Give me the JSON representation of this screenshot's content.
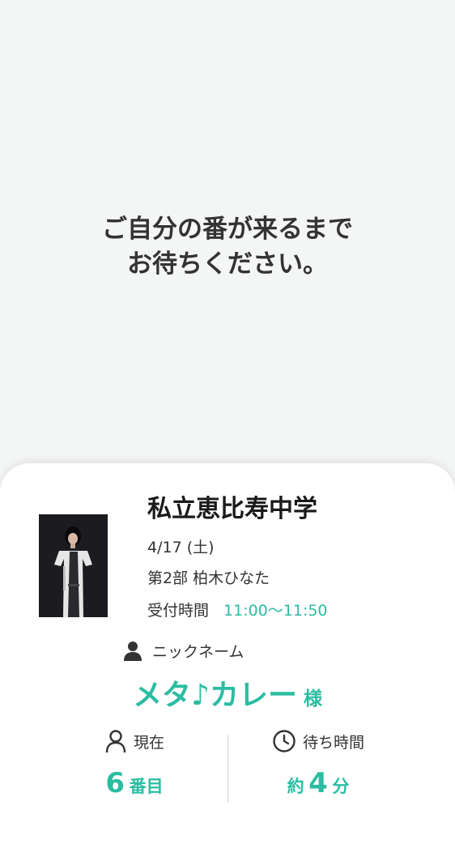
{
  "message": {
    "line1": "ご自分の番が来るまで",
    "line2": "お待ちください。"
  },
  "event": {
    "school_name": "私立恵比寿中学",
    "date": "4/17 (土)",
    "part": "第2部 柏木ひなた",
    "reception_label": "受付時間",
    "reception_time": "11:00〜11:50"
  },
  "nickname": {
    "label": "ニックネーム",
    "value": "メタ♪カレー",
    "suffix": "様"
  },
  "status": {
    "current_label": "現在",
    "current_number": "6",
    "current_unit": "番目",
    "wait_label": "待ち時間",
    "wait_prefix": "約",
    "wait_number": "4",
    "wait_unit": "分"
  },
  "colors": {
    "accent": "#2bbda2",
    "background": "#f4f5f5",
    "card": "#ffffff"
  },
  "icons": {
    "nickname": "person-filled-icon",
    "current": "person-outline-icon",
    "wait": "clock-icon"
  }
}
